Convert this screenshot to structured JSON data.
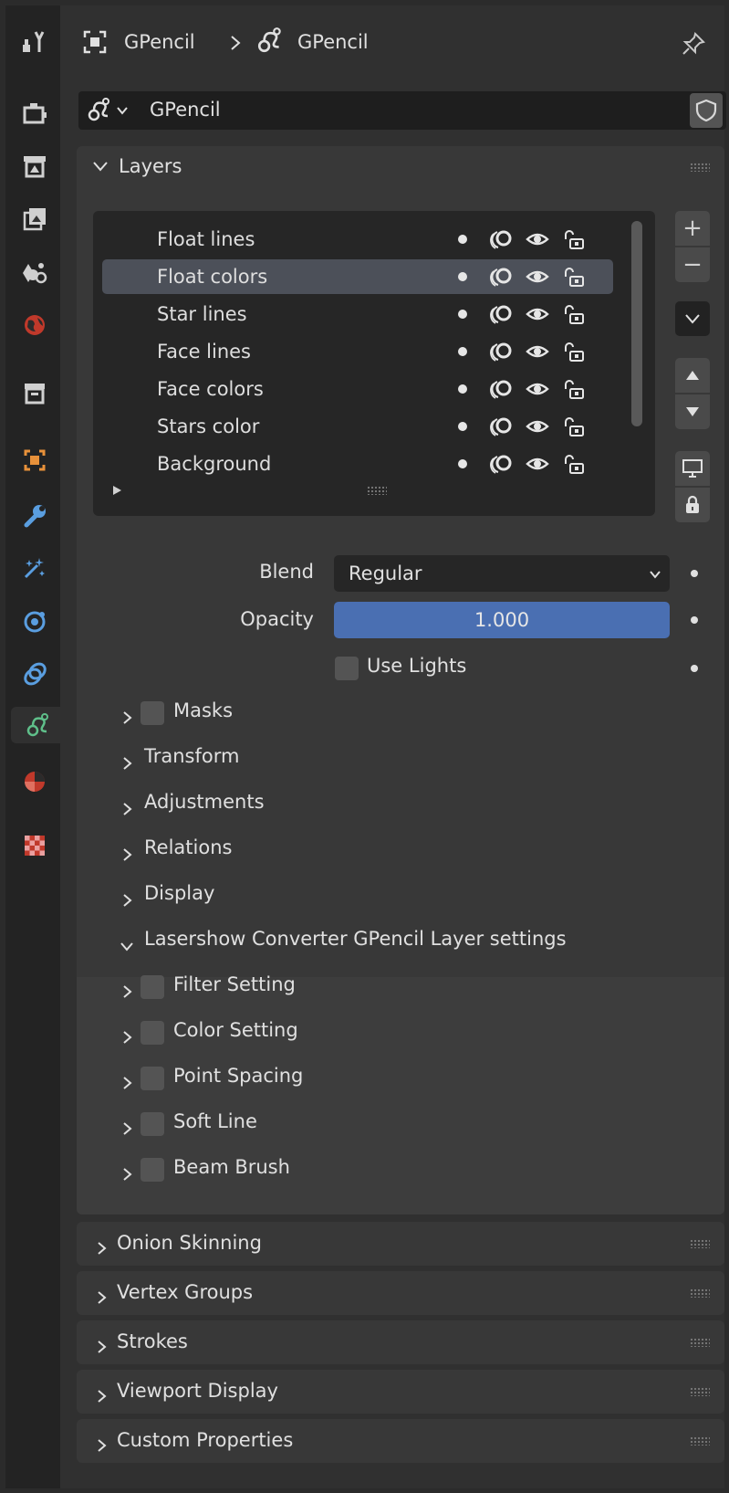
{
  "header": {
    "crumb_object": "GPencil",
    "crumb_data": "GPencil"
  },
  "datablock": {
    "name": "GPencil"
  },
  "layers_panel": {
    "title": "Layers",
    "layers": [
      {
        "name": "Float lines",
        "selected": false
      },
      {
        "name": "Float colors",
        "selected": true
      },
      {
        "name": "Star lines",
        "selected": false
      },
      {
        "name": "Face lines",
        "selected": false
      },
      {
        "name": "Face colors",
        "selected": false
      },
      {
        "name": "Stars color",
        "selected": false
      },
      {
        "name": "Background",
        "selected": false
      }
    ],
    "add_label": "+",
    "remove_label": "−"
  },
  "props": {
    "blend_label": "Blend",
    "blend_value": "Regular",
    "opacity_label": "Opacity",
    "opacity_value": "1.000",
    "opacity_fraction": 1.0,
    "use_lights_label": "Use Lights"
  },
  "subpanels": {
    "masks": "Masks",
    "transform": "Transform",
    "adjustments": "Adjustments",
    "relations": "Relations",
    "display": "Display",
    "lasershow": "Lasershow Converter GPencil Layer settings",
    "filter": "Filter Setting",
    "color": "Color Setting",
    "spacing": "Point Spacing",
    "softline": "Soft Line",
    "beam": "Beam Brush"
  },
  "panels": {
    "onion": "Onion Skinning",
    "vgroups": "Vertex Groups",
    "strokes": "Strokes",
    "viewport": "Viewport Display",
    "custom": "Custom Properties"
  },
  "colors": {
    "accent": "#4a6fb2",
    "active_tab_icon": "#5fbf8a"
  }
}
